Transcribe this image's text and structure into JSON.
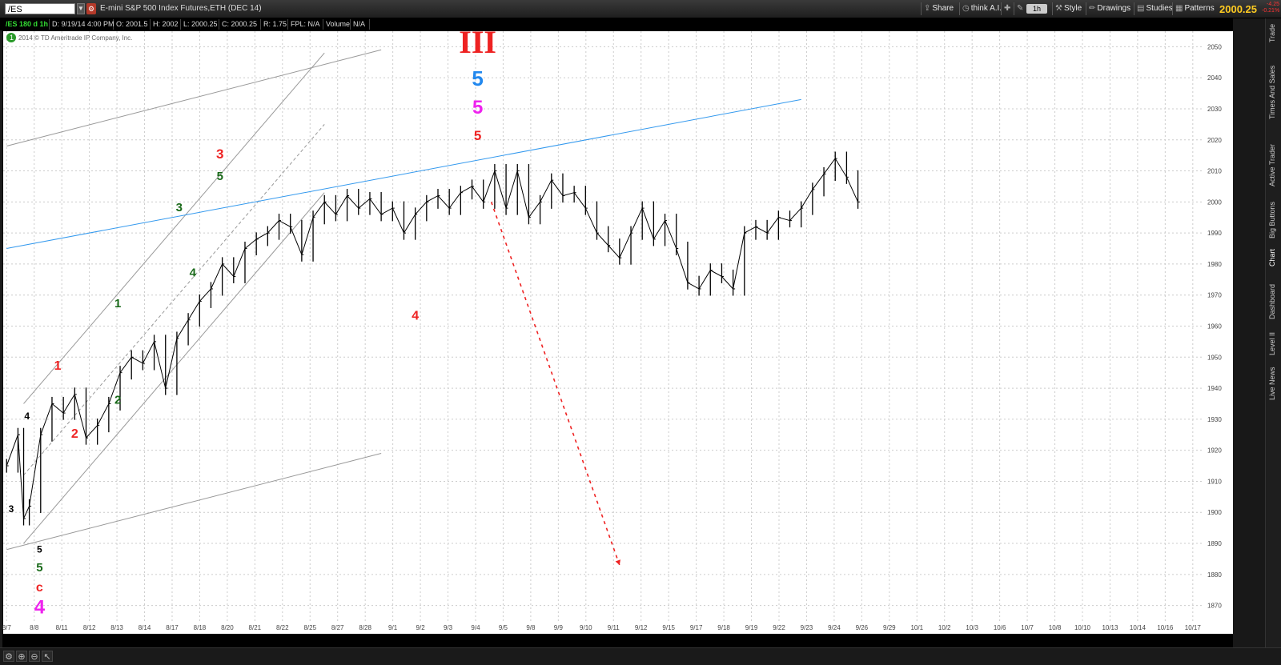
{
  "toolbar": {
    "symbol": "/ES",
    "description": "E-mini S&P 500 Index Futures,ETH (DEC 14)",
    "share_label": "Share",
    "think_label": "think A.I.",
    "aggregation": "1h",
    "style_label": "Style",
    "drawings_label": "Drawings",
    "studies_label": "Studies",
    "patterns_label": "Patterns",
    "last_price": "2000.25",
    "net_change": "-4.25",
    "pct_change": "-0.21%"
  },
  "infobar": {
    "chart_id": "/ES 180 d 1h",
    "date": "D: 9/19/14 4:00 PM",
    "open": "O: 2001.5",
    "high": "H: 2002",
    "low": "L: 2000.25",
    "close": "C: 2000.25",
    "range": "R: 1.75",
    "fpl": "FPL: N/A",
    "volume_label": "Volume",
    "volume_value": "N/A"
  },
  "copyright": "2014 © TD Ameritrade IP Company, Inc.",
  "sidebar": {
    "tabs": [
      "Trade",
      "Times And Sales",
      "Active Trader",
      "Big Buttons",
      "Chart",
      "Dashboard",
      "Level II",
      "Live News"
    ]
  },
  "colors": {
    "background": "#ffffff",
    "grid": "#cccccc",
    "price_bars": "#000000",
    "channel_lines": "#999999",
    "trendline": "#3399ee",
    "projection": "#ee2222",
    "red_labels": "#ee2222",
    "green_labels": "#1a6a1a",
    "magenta_labels": "#ee22ee",
    "blue_labels": "#2288ee"
  },
  "chart_data": {
    "type": "line",
    "title": "",
    "xlabel": "",
    "ylabel": "",
    "ylim": [
      1865,
      2055
    ],
    "y_ticks": [
      1870,
      1880,
      1890,
      1900,
      1910,
      1920,
      1930,
      1940,
      1950,
      1960,
      1970,
      1980,
      1990,
      2000,
      2010,
      2020,
      2030,
      2040,
      2050
    ],
    "x_ticks": [
      "8/7",
      "8/8",
      "8/11",
      "8/12",
      "8/13",
      "8/14",
      "8/17",
      "8/18",
      "8/20",
      "8/21",
      "8/22",
      "8/25",
      "8/27",
      "8/28",
      "9/1",
      "9/2",
      "9/3",
      "9/4",
      "9/5",
      "9/8",
      "9/9",
      "9/10",
      "9/11",
      "9/12",
      "9/15",
      "9/17",
      "9/18",
      "9/19",
      "9/22",
      "9/23",
      "9/24",
      "9/26",
      "9/29",
      "10/1",
      "10/2",
      "10/3",
      "10/6",
      "10/7",
      "10/8",
      "10/10",
      "10/13",
      "10/14",
      "10/16",
      "10/17"
    ],
    "grid": true,
    "series": [
      {
        "values": [
          [
            0,
            1915
          ],
          [
            1,
            1925
          ],
          [
            1.5,
            1898
          ],
          [
            2,
            1902
          ],
          [
            3,
            1925
          ],
          [
            4,
            1935
          ],
          [
            5,
            1932
          ],
          [
            6,
            1938
          ],
          [
            7,
            1924
          ],
          [
            8,
            1928
          ],
          [
            9,
            1935
          ],
          [
            10,
            1945
          ],
          [
            11,
            1950
          ],
          [
            12,
            1948
          ],
          [
            13,
            1955
          ],
          [
            14,
            1940
          ],
          [
            15,
            1956
          ],
          [
            16,
            1962
          ],
          [
            17,
            1968
          ],
          [
            18,
            1972
          ],
          [
            19,
            1980
          ],
          [
            20,
            1976
          ],
          [
            21,
            1985
          ],
          [
            22,
            1988
          ],
          [
            23,
            1990
          ],
          [
            24,
            1994
          ],
          [
            25,
            1992
          ],
          [
            26,
            1983
          ],
          [
            27,
            1995
          ],
          [
            28,
            2000
          ],
          [
            29,
            1996
          ],
          [
            30,
            2002
          ],
          [
            31,
            1998
          ],
          [
            32,
            2001
          ],
          [
            33,
            1996
          ],
          [
            34,
            1998
          ],
          [
            35,
            1990
          ],
          [
            36,
            1996
          ],
          [
            37,
            2000
          ],
          [
            38,
            2002
          ],
          [
            39,
            1998
          ],
          [
            40,
            2003
          ],
          [
            41,
            2005
          ],
          [
            42,
            2000
          ],
          [
            43,
            2010
          ],
          [
            44,
            1998
          ],
          [
            45,
            2010
          ],
          [
            46,
            1995
          ],
          [
            47,
            2000
          ],
          [
            48,
            2007
          ],
          [
            49,
            2002
          ],
          [
            50,
            2003
          ],
          [
            51,
            1998
          ],
          [
            52,
            1990
          ],
          [
            53,
            1986
          ],
          [
            54,
            1982
          ],
          [
            55,
            1990
          ],
          [
            56,
            1998
          ],
          [
            57,
            1988
          ],
          [
            58,
            1994
          ],
          [
            59,
            1985
          ],
          [
            60,
            1974
          ],
          [
            61,
            1972
          ],
          [
            62,
            1978
          ],
          [
            63,
            1976
          ],
          [
            64,
            1972
          ],
          [
            65,
            1990
          ],
          [
            66,
            1992
          ],
          [
            67,
            1990
          ],
          [
            68,
            1995
          ],
          [
            69,
            1994
          ],
          [
            70,
            1998
          ],
          [
            71,
            2004
          ],
          [
            72,
            2009
          ],
          [
            73,
            2014
          ],
          [
            74,
            2008
          ],
          [
            75,
            2000
          ]
        ]
      }
    ],
    "lines": [
      {
        "name": "channel-upper",
        "from": [
          0,
          2018
        ],
        "to": [
          33,
          2049
        ]
      },
      {
        "name": "channel-lower",
        "from": [
          0,
          1888
        ],
        "to": [
          33,
          1919
        ]
      },
      {
        "name": "inner-channel-upper",
        "from": [
          1.5,
          1935
        ],
        "to": [
          28,
          2048
        ]
      },
      {
        "name": "inner-channel-lower",
        "from": [
          1.5,
          1890
        ],
        "to": [
          28,
          2003
        ]
      },
      {
        "name": "inner-channel-mid",
        "from": [
          1.5,
          1912
        ],
        "to": [
          28,
          2025
        ]
      },
      {
        "name": "trendline",
        "from": [
          0,
          1985
        ],
        "to": [
          70,
          2033
        ]
      },
      {
        "name": "projection",
        "from": [
          42.7,
          2000
        ],
        "to": [
          54,
          1883
        ]
      }
    ],
    "annotations": [
      {
        "text": "III",
        "x": 41.5,
        "y": 2048,
        "color": "#ee2222",
        "size": 40,
        "serif": true
      },
      {
        "text": "5",
        "x": 41.5,
        "y": 2037.5,
        "color": "#2288ee",
        "size": 26
      },
      {
        "text": "5",
        "x": 41.5,
        "y": 2028.5,
        "color": "#ee22ee",
        "size": 24
      },
      {
        "text": "5",
        "x": 41.5,
        "y": 2020,
        "color": "#ee2222",
        "size": 17
      },
      {
        "text": "3",
        "x": 18.8,
        "y": 2014,
        "color": "#ee2222",
        "size": 17
      },
      {
        "text": "5",
        "x": 18.8,
        "y": 2007,
        "color": "#1a6a1a",
        "size": 15
      },
      {
        "text": "3",
        "x": 15.2,
        "y": 1997,
        "color": "#1a6a1a",
        "size": 15
      },
      {
        "text": "4",
        "x": 16.4,
        "y": 1976,
        "color": "#1a6a1a",
        "size": 15
      },
      {
        "text": "1",
        "x": 9.8,
        "y": 1966,
        "color": "#1a6a1a",
        "size": 15
      },
      {
        "text": "2",
        "x": 9.8,
        "y": 1935,
        "color": "#1a6a1a",
        "size": 15
      },
      {
        "text": "1",
        "x": 4.5,
        "y": 1946,
        "color": "#ee2222",
        "size": 16
      },
      {
        "text": "2",
        "x": 6.0,
        "y": 1924,
        "color": "#ee2222",
        "size": 16
      },
      {
        "text": "4",
        "x": 36.0,
        "y": 1962,
        "color": "#ee2222",
        "size": 16
      },
      {
        "text": "4",
        "x": 1.8,
        "y": 1930,
        "color": "#000000",
        "size": 12
      },
      {
        "text": "3",
        "x": 0.4,
        "y": 1900,
        "color": "#000000",
        "size": 12
      },
      {
        "text": "5",
        "x": 2.9,
        "y": 1887,
        "color": "#000000",
        "size": 12
      },
      {
        "text": "5",
        "x": 2.9,
        "y": 1881,
        "color": "#1a6a1a",
        "size": 15
      },
      {
        "text": "c",
        "x": 2.9,
        "y": 1874.5,
        "color": "#ee2222",
        "size": 16
      },
      {
        "text": "4",
        "x": 2.9,
        "y": 1867.5,
        "color": "#ee22ee",
        "size": 24
      }
    ]
  }
}
